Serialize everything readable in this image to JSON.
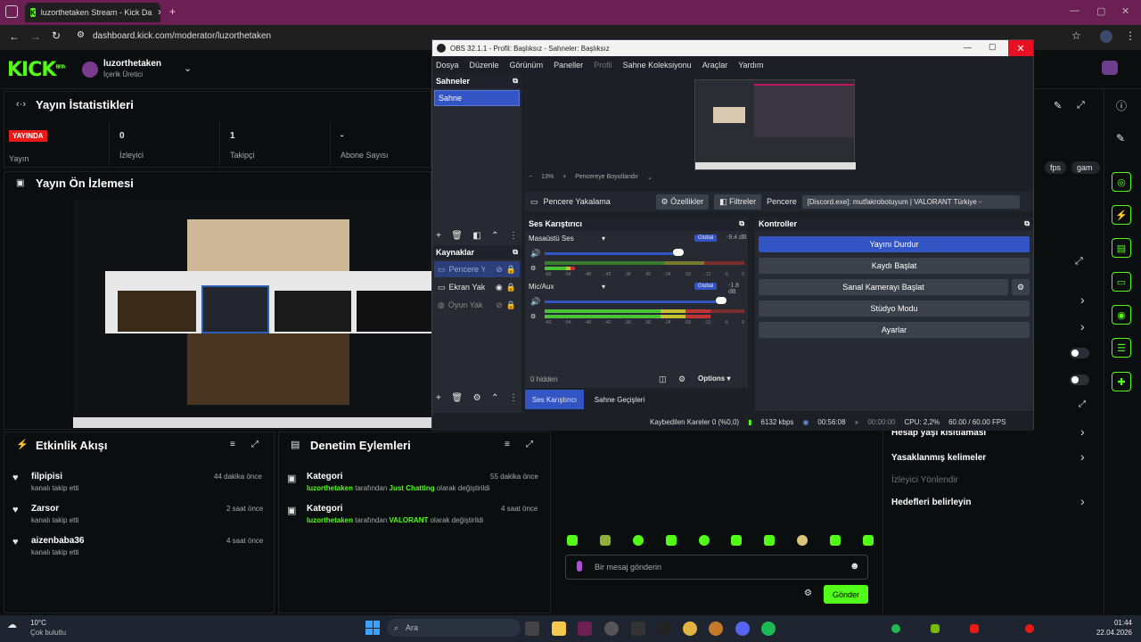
{
  "browser": {
    "tab_title": "luzorthetaken Stream - Kick Da",
    "url": "dashboard.kick.com/moderator/luzorthetaken"
  },
  "kick": {
    "logo": "KICK",
    "logo_sup": "BETA",
    "channel_name": "luzorthetaken",
    "channel_role": "İçerik Üretici"
  },
  "stats": {
    "title": "Yayın İstatistikleri",
    "live_badge": "YAYINDA",
    "live_label": "Yayın",
    "viewers_value": "0",
    "viewers_label": "İzleyici",
    "followers_value": "1",
    "followers_label": "Takipçi",
    "subs_value": "-",
    "subs_label": "Abone Sayısı"
  },
  "preview": {
    "title": "Yayın Ön İzlemesi"
  },
  "activity": {
    "title": "Etkinlik Akışı",
    "items": [
      {
        "name": "filpipisi",
        "sub": "kanalı takip etti",
        "time": "44 dakika önce"
      },
      {
        "name": "Zarsor",
        "sub": "kanalı takip etti",
        "time": "2 saat önce"
      },
      {
        "name": "aizenbaba36",
        "sub": "kanalı takip etti",
        "time": "4 saat önce"
      }
    ]
  },
  "moderation": {
    "title": "Denetim Eylemleri",
    "items": [
      {
        "title": "Kategori",
        "user": "luzorthetaken",
        "mid": "tarafından",
        "cat": "Just Chatting",
        "end": "olarak değiştirildi",
        "time": "55 dakika önce"
      },
      {
        "title": "Kategori",
        "user": "luzorthetaken",
        "mid": "tarafından",
        "cat": "VALORANT",
        "end": "olarak değiştirildi",
        "time": "4 saat önce"
      }
    ]
  },
  "right_panel": {
    "tags": [
      "fps",
      "gam"
    ],
    "items": [
      "Hesap yaşı kısıtlaması",
      "Yasaklanmış kelimeler",
      "İzleyici Yönlendir",
      "Hedefleri belirleyin"
    ]
  },
  "chat": {
    "placeholder": "Bir mesaj gönderin",
    "send": "Gönder"
  },
  "obs": {
    "title": "OBS 32.1.1 - Profil: Başlıksız - Sahneler: Başlıksız",
    "menu": [
      "Dosya",
      "Düzenle",
      "Görünüm",
      "Paneller",
      "Profil",
      "Sahne Koleksiyonu",
      "Araçlar",
      "Yardım"
    ],
    "scenes_title": "Sahneler",
    "scene": "Sahne",
    "sources_title": "Kaynaklar",
    "sources": [
      "Pencere Y",
      "Ekran Yak",
      "Oyun Yak"
    ],
    "zoom": "13%",
    "fit_label": "Pencereye Boyutlandır",
    "capture_label": "Pencere Yakalama",
    "props_label": "Özellikler",
    "filters_label": "Filtreler",
    "window_label": "Pencere",
    "window_value": "[Discord.exe]: mutfakrobotuyum | VALORANT Türkiye -",
    "mixer_title": "Ses Karıştırıcı",
    "track1_name": "Masaüstü Ses",
    "track1_db": "-9.4 dB",
    "track2_name": "Mic/Aux",
    "track2_db": "-1.8 dB",
    "global_label": "Global",
    "meter_ticks": [
      "-60",
      "-54",
      "-48",
      "-42",
      "-36",
      "-30",
      "-24",
      "-18",
      "-12",
      "-6",
      "0"
    ],
    "hidden_label": "0 hidden",
    "options_label": "Options",
    "controls_title": "Kontroller",
    "controls": [
      "Yayını Durdur",
      "Kaydı Başlat",
      "Sanal Kamerayı Başlat",
      "Stüdyo Modu",
      "Ayarlar"
    ],
    "tab_mixer": "Ses Karıştırıcı",
    "tab_transitions": "Sahne Geçişleri",
    "status_dropped": "Kaybedilen Kareler 0 (%0,0)",
    "status_kbps": "6132 kbps",
    "status_live": "00:56:08",
    "status_rec": "00:00:00",
    "status_cpu": "CPU: 2,2%",
    "status_fps": "60.00 / 60.00 FPS"
  },
  "taskbar": {
    "weather_temp": "10°C",
    "weather_desc": "Çok bulutlu",
    "search": "Ara",
    "time": "01:44",
    "date": "22.04.2026"
  }
}
